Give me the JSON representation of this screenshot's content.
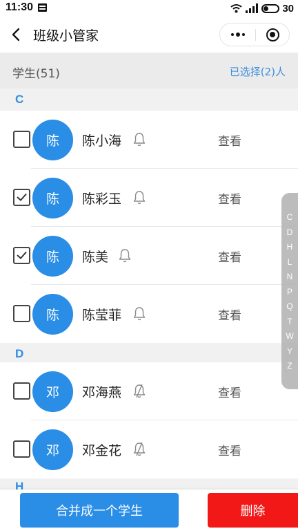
{
  "status_bar": {
    "time": "11:30",
    "signal": "⁴ᴳııl",
    "battery": "30"
  },
  "nav": {
    "title": "班级小管家"
  },
  "list_header": {
    "title": "学生(51)",
    "selected": "已选择(2)人"
  },
  "sections": [
    {
      "letter": "C",
      "students": [
        {
          "avatar": "陈",
          "name": "陈小海",
          "checked": false,
          "bell": "bell-icon",
          "action": "查看"
        },
        {
          "avatar": "陈",
          "name": "陈彩玉",
          "checked": true,
          "bell": "bell-icon",
          "action": "查看"
        },
        {
          "avatar": "陈",
          "name": "陈美",
          "checked": true,
          "bell": "bell-icon",
          "action": "查看"
        },
        {
          "avatar": "陈",
          "name": "陈莹菲",
          "checked": false,
          "bell": "bell-icon",
          "action": "查看"
        }
      ]
    },
    {
      "letter": "D",
      "students": [
        {
          "avatar": "邓",
          "name": "邓海燕",
          "checked": false,
          "bell": "bell-off-icon",
          "action": "查看"
        },
        {
          "avatar": "邓",
          "name": "邓金花",
          "checked": false,
          "bell": "bell-off-icon",
          "action": "查看"
        }
      ]
    }
  ],
  "next_section_letter": "H",
  "index_bar": [
    "C",
    "D",
    "H",
    "L",
    "N",
    "P",
    "Q",
    "T",
    "W",
    "Y",
    "Z"
  ],
  "bottom": {
    "merge_label": "合并成一个学生",
    "delete_label": "删除"
  },
  "colors": {
    "accent": "#2a8de6",
    "link": "#3f8fdb",
    "danger": "#f21818",
    "section_letter": "#2f8de4"
  }
}
